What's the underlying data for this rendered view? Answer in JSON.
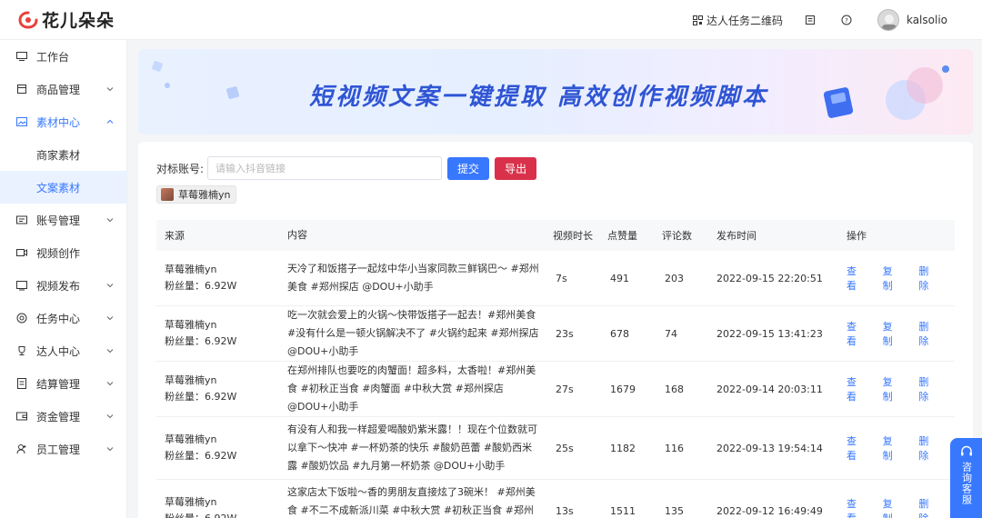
{
  "header": {
    "logo_text": "花儿朵朵",
    "qr_label": "达人任务二维码",
    "username": "kalsolio"
  },
  "sidebar": {
    "items": [
      {
        "label": "工作台",
        "icon": "monitor-icon",
        "chevron": false
      },
      {
        "label": "商品管理",
        "icon": "box-icon",
        "chevron": true
      },
      {
        "label": "素材中心",
        "icon": "image-icon",
        "chevron": true,
        "open": true,
        "children": [
          {
            "label": "商家素材",
            "active": false
          },
          {
            "label": "文案素材",
            "active": true
          }
        ]
      },
      {
        "label": "账号管理",
        "icon": "id-card-icon",
        "chevron": true
      },
      {
        "label": "视频创作",
        "icon": "video-icon",
        "chevron": false
      },
      {
        "label": "视频发布",
        "icon": "publish-icon",
        "chevron": true
      },
      {
        "label": "任务中心",
        "icon": "target-icon",
        "chevron": true
      },
      {
        "label": "达人中心",
        "icon": "trophy-icon",
        "chevron": true
      },
      {
        "label": "结算管理",
        "icon": "ledger-icon",
        "chevron": true
      },
      {
        "label": "资金管理",
        "icon": "wallet-icon",
        "chevron": true
      },
      {
        "label": "员工管理",
        "icon": "user-add-icon",
        "chevron": true
      }
    ]
  },
  "banner": {
    "title": "短视频文案一键提取 高效创作视频脚本"
  },
  "filter": {
    "label": "对标账号:",
    "placeholder": "请输入抖音链接",
    "submit_label": "提交",
    "export_label": "导出"
  },
  "tag": {
    "label": "草莓雅楠yn"
  },
  "table": {
    "headers": {
      "source": "来源",
      "content": "内容",
      "duration": "视频时长",
      "likes": "点赞量",
      "comments": "评论数",
      "time": "发布时间",
      "ops": "操作"
    },
    "op_labels": {
      "view": "查看",
      "copy": "复制",
      "delete": "删除"
    },
    "rows": [
      {
        "name": "草莓雅楠yn",
        "fans": "粉丝量：6.92W",
        "content": "天冷了和饭搭子一起炫中华小当家同款三鲜锅巴～ #郑州美食 #郑州探店 @DOU+小助手",
        "duration": "7s",
        "likes": "491",
        "comments": "203",
        "time": "2022-09-15 22:20:51"
      },
      {
        "name": "草莓雅楠yn",
        "fans": "粉丝量：6.92W",
        "content": "吃一次就会爱上的火锅～快带饭搭子一起去！#郑州美食 #没有什么是一顿火锅解决不了 #火锅约起来 #郑州探店 @DOU+小助手",
        "duration": "23s",
        "likes": "678",
        "comments": "74",
        "time": "2022-09-15 13:41:23"
      },
      {
        "name": "草莓雅楠yn",
        "fans": "粉丝量：6.92W",
        "content": "在郑州排队也要吃的肉蟹面！超多料，太香啦！#郑州美食 #初秋正当食 #肉蟹面 #中秋大赏 #郑州探店 @DOU+小助手",
        "duration": "27s",
        "likes": "1679",
        "comments": "168",
        "time": "2022-09-14 20:03:11"
      },
      {
        "name": "草莓雅楠yn",
        "fans": "粉丝量：6.92W",
        "content": "有没有人和我一样超爱喝酸奶紫米露！！现在个位数就可以拿下～快冲 #一杯奶茶的快乐 #酸奶芭蕾 #酸奶西米露 #酸奶饮品 #九月第一杯奶茶 @DOU+小助手",
        "duration": "25s",
        "likes": "1182",
        "comments": "116",
        "time": "2022-09-13 19:54:14"
      },
      {
        "name": "草莓雅楠yn",
        "fans": "粉丝量：6.92W",
        "content": "这家店太下饭啦～香的男朋友直接炫了3碗米！ #郑州美食 #不二不成新派川菜 #中秋大赏 #初秋正当食 #郑州探店 @DOU+小助手",
        "duration": "13s",
        "likes": "1511",
        "comments": "135",
        "time": "2022-09-12 16:49:49"
      }
    ]
  },
  "service": {
    "label": "咨询客服"
  }
}
